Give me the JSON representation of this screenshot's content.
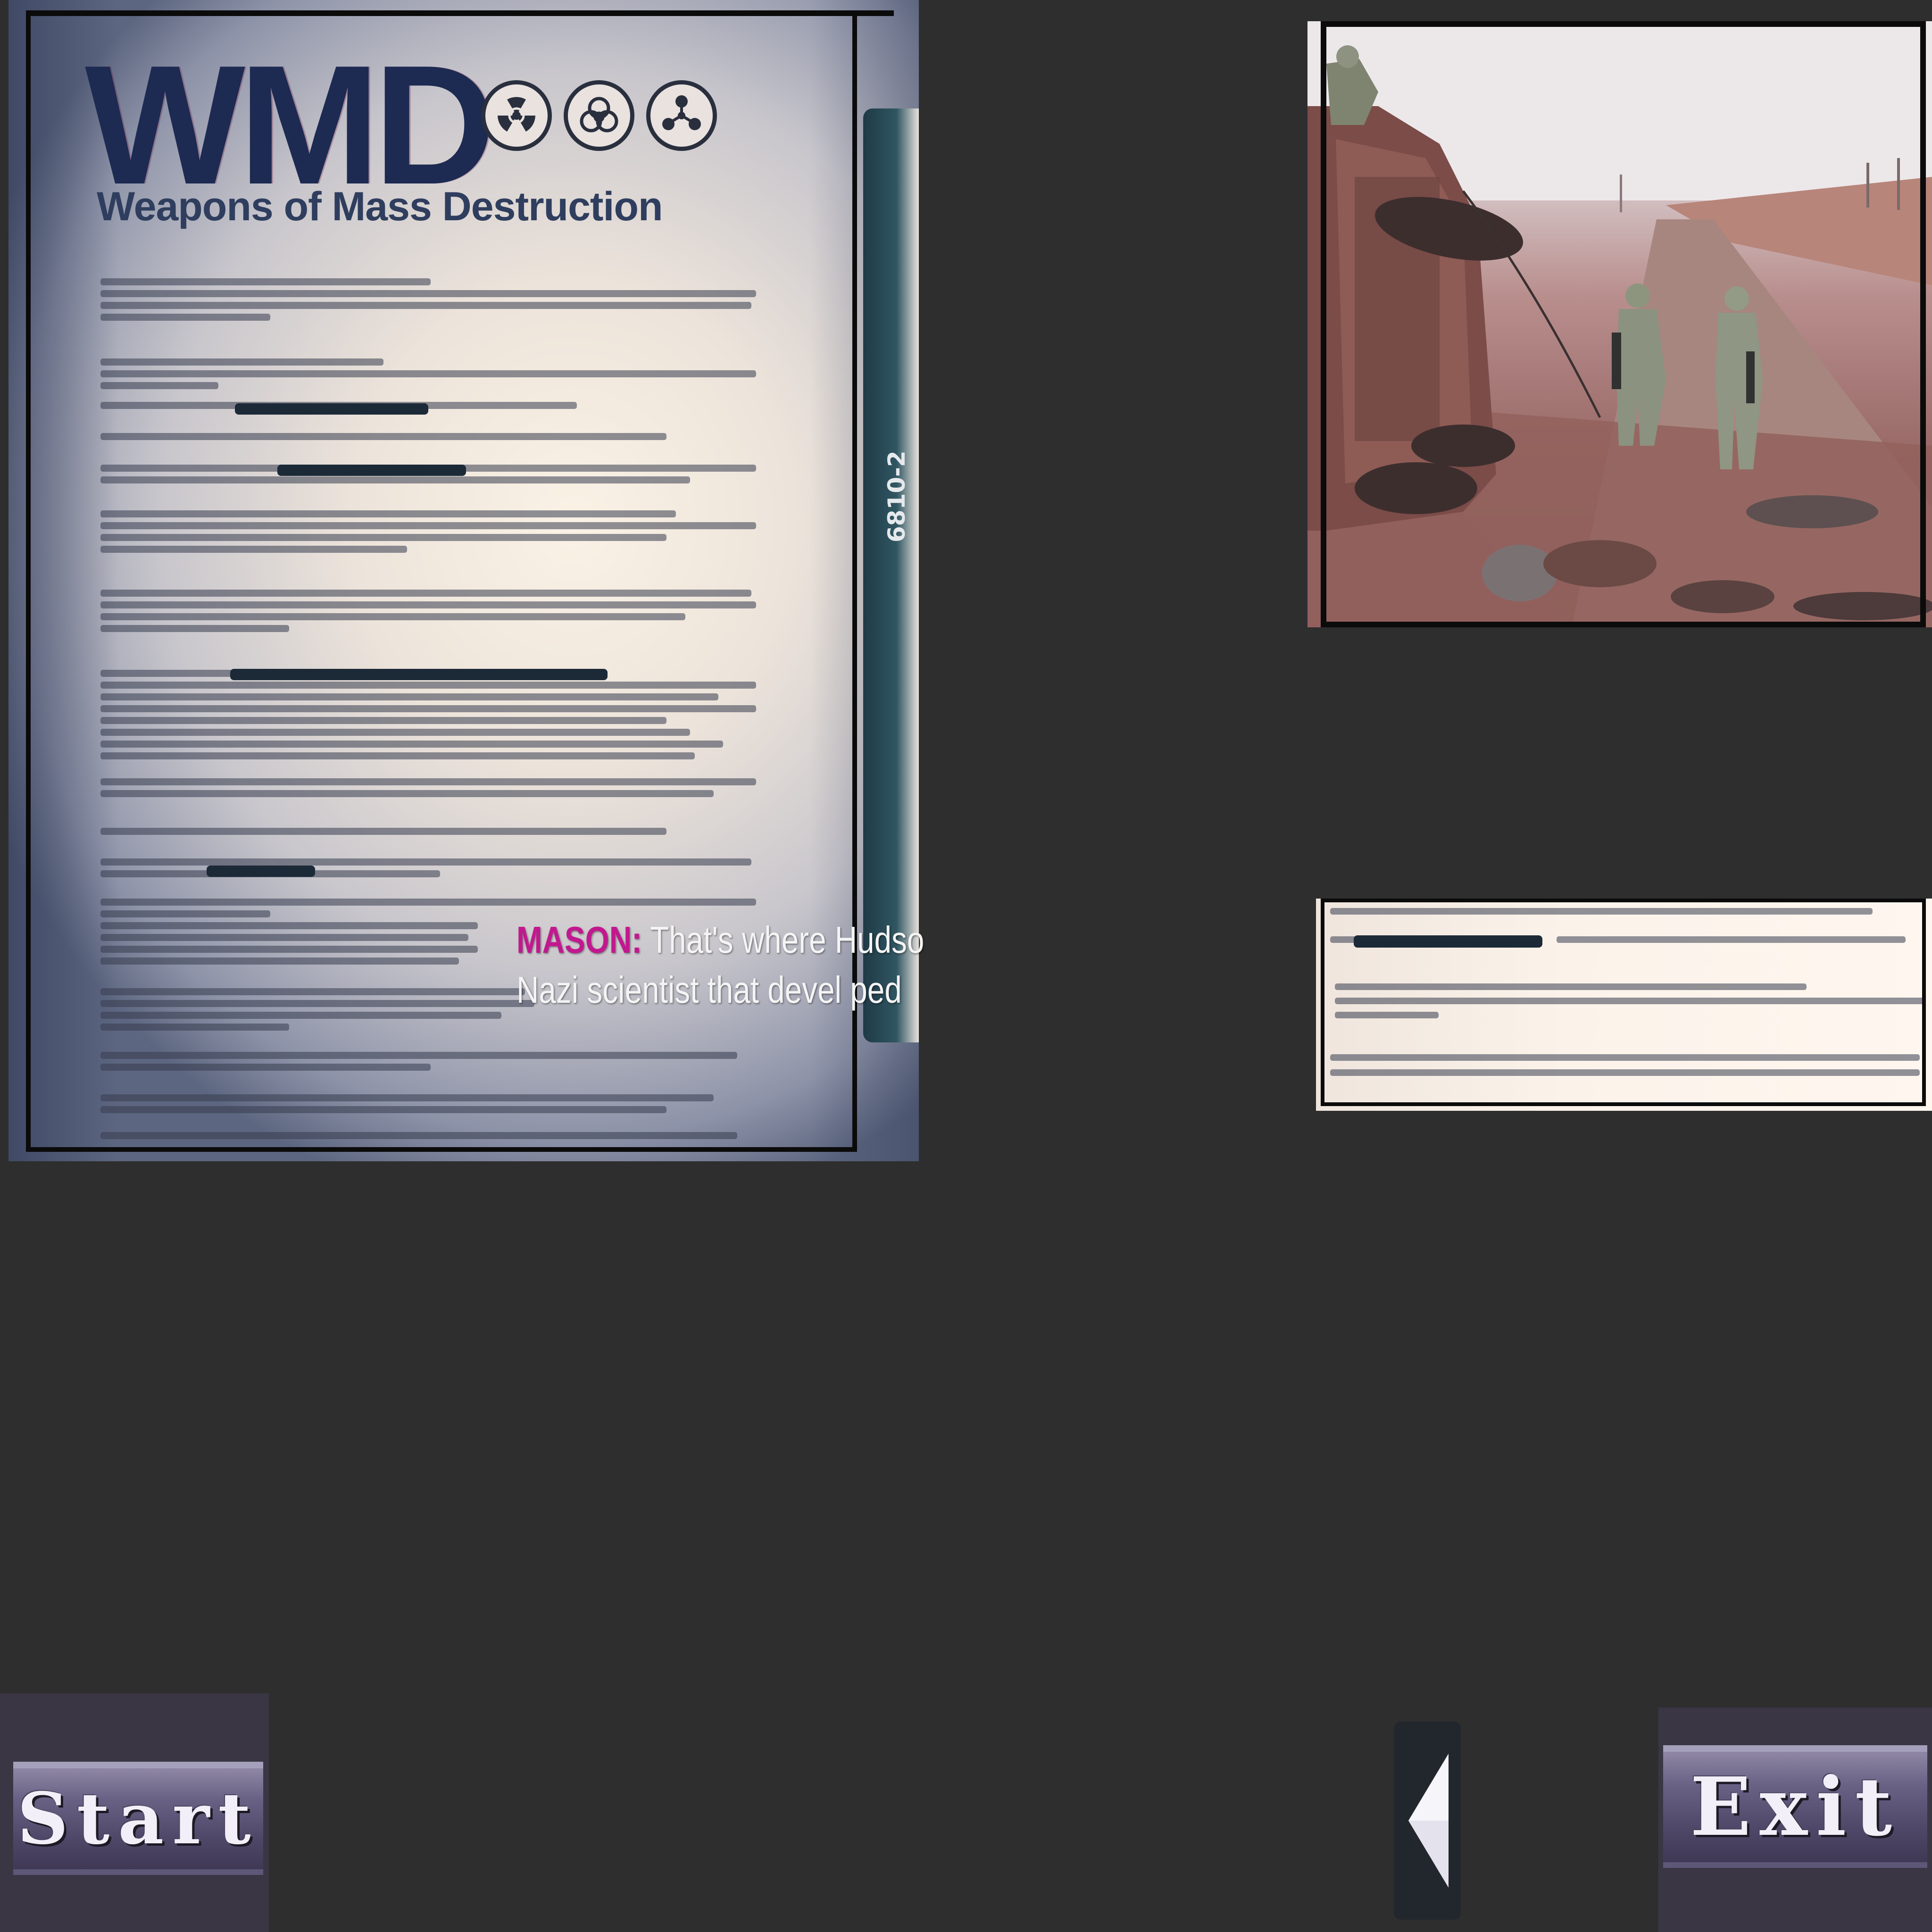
{
  "document": {
    "title": "WMD",
    "subtitle": "Weapons of Mass Destruction",
    "strip_text": "6810-2",
    "hazard_symbols": [
      "radiation-icon",
      "biohazard-icon",
      "chemical-hazard-icon"
    ]
  },
  "dialogue": {
    "speaker": "MASON:",
    "line1": "That's where Hudso",
    "line2": "Nazi scientist that devel ped"
  },
  "photo": {
    "description_icon": "soldiers-overturned-vehicle-photo"
  },
  "buttons": {
    "start_label": "Start",
    "exit_label": "Exit",
    "back_icon": "back-arrow-icon"
  },
  "colors": {
    "background": "#2e2e2e",
    "speaker": "#c2188f",
    "title_ink": "#1d2a52",
    "button_face": "#4e4767"
  }
}
